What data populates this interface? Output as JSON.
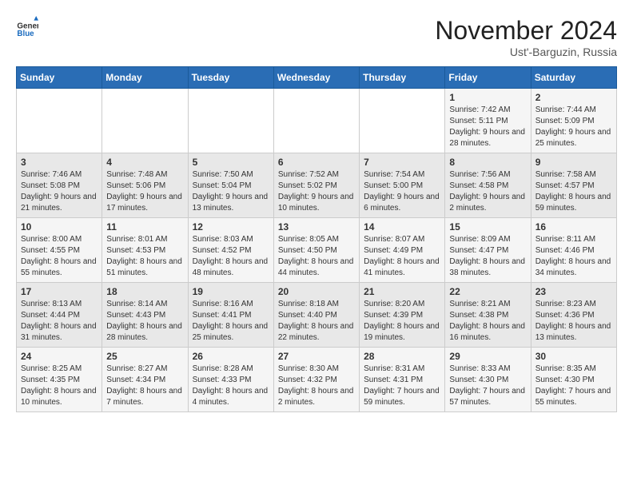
{
  "header": {
    "logo_general": "General",
    "logo_blue": "Blue",
    "month_title": "November 2024",
    "location": "Ust'-Barguzin, Russia"
  },
  "weekdays": [
    "Sunday",
    "Monday",
    "Tuesday",
    "Wednesday",
    "Thursday",
    "Friday",
    "Saturday"
  ],
  "weeks": [
    [
      {
        "day": "",
        "info": ""
      },
      {
        "day": "",
        "info": ""
      },
      {
        "day": "",
        "info": ""
      },
      {
        "day": "",
        "info": ""
      },
      {
        "day": "",
        "info": ""
      },
      {
        "day": "1",
        "info": "Sunrise: 7:42 AM\nSunset: 5:11 PM\nDaylight: 9 hours and 28 minutes."
      },
      {
        "day": "2",
        "info": "Sunrise: 7:44 AM\nSunset: 5:09 PM\nDaylight: 9 hours and 25 minutes."
      }
    ],
    [
      {
        "day": "3",
        "info": "Sunrise: 7:46 AM\nSunset: 5:08 PM\nDaylight: 9 hours and 21 minutes."
      },
      {
        "day": "4",
        "info": "Sunrise: 7:48 AM\nSunset: 5:06 PM\nDaylight: 9 hours and 17 minutes."
      },
      {
        "day": "5",
        "info": "Sunrise: 7:50 AM\nSunset: 5:04 PM\nDaylight: 9 hours and 13 minutes."
      },
      {
        "day": "6",
        "info": "Sunrise: 7:52 AM\nSunset: 5:02 PM\nDaylight: 9 hours and 10 minutes."
      },
      {
        "day": "7",
        "info": "Sunrise: 7:54 AM\nSunset: 5:00 PM\nDaylight: 9 hours and 6 minutes."
      },
      {
        "day": "8",
        "info": "Sunrise: 7:56 AM\nSunset: 4:58 PM\nDaylight: 9 hours and 2 minutes."
      },
      {
        "day": "9",
        "info": "Sunrise: 7:58 AM\nSunset: 4:57 PM\nDaylight: 8 hours and 59 minutes."
      }
    ],
    [
      {
        "day": "10",
        "info": "Sunrise: 8:00 AM\nSunset: 4:55 PM\nDaylight: 8 hours and 55 minutes."
      },
      {
        "day": "11",
        "info": "Sunrise: 8:01 AM\nSunset: 4:53 PM\nDaylight: 8 hours and 51 minutes."
      },
      {
        "day": "12",
        "info": "Sunrise: 8:03 AM\nSunset: 4:52 PM\nDaylight: 8 hours and 48 minutes."
      },
      {
        "day": "13",
        "info": "Sunrise: 8:05 AM\nSunset: 4:50 PM\nDaylight: 8 hours and 44 minutes."
      },
      {
        "day": "14",
        "info": "Sunrise: 8:07 AM\nSunset: 4:49 PM\nDaylight: 8 hours and 41 minutes."
      },
      {
        "day": "15",
        "info": "Sunrise: 8:09 AM\nSunset: 4:47 PM\nDaylight: 8 hours and 38 minutes."
      },
      {
        "day": "16",
        "info": "Sunrise: 8:11 AM\nSunset: 4:46 PM\nDaylight: 8 hours and 34 minutes."
      }
    ],
    [
      {
        "day": "17",
        "info": "Sunrise: 8:13 AM\nSunset: 4:44 PM\nDaylight: 8 hours and 31 minutes."
      },
      {
        "day": "18",
        "info": "Sunrise: 8:14 AM\nSunset: 4:43 PM\nDaylight: 8 hours and 28 minutes."
      },
      {
        "day": "19",
        "info": "Sunrise: 8:16 AM\nSunset: 4:41 PM\nDaylight: 8 hours and 25 minutes."
      },
      {
        "day": "20",
        "info": "Sunrise: 8:18 AM\nSunset: 4:40 PM\nDaylight: 8 hours and 22 minutes."
      },
      {
        "day": "21",
        "info": "Sunrise: 8:20 AM\nSunset: 4:39 PM\nDaylight: 8 hours and 19 minutes."
      },
      {
        "day": "22",
        "info": "Sunrise: 8:21 AM\nSunset: 4:38 PM\nDaylight: 8 hours and 16 minutes."
      },
      {
        "day": "23",
        "info": "Sunrise: 8:23 AM\nSunset: 4:36 PM\nDaylight: 8 hours and 13 minutes."
      }
    ],
    [
      {
        "day": "24",
        "info": "Sunrise: 8:25 AM\nSunset: 4:35 PM\nDaylight: 8 hours and 10 minutes."
      },
      {
        "day": "25",
        "info": "Sunrise: 8:27 AM\nSunset: 4:34 PM\nDaylight: 8 hours and 7 minutes."
      },
      {
        "day": "26",
        "info": "Sunrise: 8:28 AM\nSunset: 4:33 PM\nDaylight: 8 hours and 4 minutes."
      },
      {
        "day": "27",
        "info": "Sunrise: 8:30 AM\nSunset: 4:32 PM\nDaylight: 8 hours and 2 minutes."
      },
      {
        "day": "28",
        "info": "Sunrise: 8:31 AM\nSunset: 4:31 PM\nDaylight: 7 hours and 59 minutes."
      },
      {
        "day": "29",
        "info": "Sunrise: 8:33 AM\nSunset: 4:30 PM\nDaylight: 7 hours and 57 minutes."
      },
      {
        "day": "30",
        "info": "Sunrise: 8:35 AM\nSunset: 4:30 PM\nDaylight: 7 hours and 55 minutes."
      }
    ]
  ]
}
